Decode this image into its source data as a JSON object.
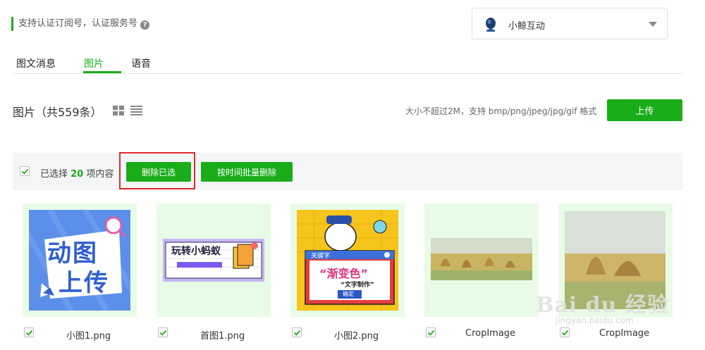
{
  "header": {
    "notice": "支持认证订阅号，认证服务号",
    "help_icon": "?",
    "account_name": "小鲸互动"
  },
  "tabs": [
    {
      "label": "图文消息",
      "active": false
    },
    {
      "label": "图片",
      "active": true
    },
    {
      "label": "语音",
      "active": false
    }
  ],
  "section": {
    "title": "图片（共559条）",
    "upload_hint": "大小不超过2M，支持 bmp/png/jpeg/jpg/gif 格式",
    "upload_label": "上传"
  },
  "toolbar": {
    "selected_prefix": "已选择",
    "selected_count": "20",
    "selected_suffix": "项内容",
    "delete_selected_label": "删除已选",
    "batch_delete_label": "按时间批量删除"
  },
  "images": [
    {
      "name": "小图1.png",
      "checked": true
    },
    {
      "name": "首图1.png",
      "checked": true
    },
    {
      "name": "小图2.png",
      "checked": true
    },
    {
      "name": "CropImage",
      "checked": true
    },
    {
      "name": "CropImage",
      "checked": true
    }
  ],
  "thumb_text": {
    "img1_line1": "动图",
    "img1_line2": "上传",
    "img2_text": "玩转小蚂蚁",
    "img3_label": "关键字",
    "img3_main": "“渐变色”",
    "img3_sub": "“文字制作”",
    "img3_btn": "确定"
  },
  "watermark": {
    "text": "Bai du 经验",
    "sub": "jingyan.baidu.com"
  },
  "colors": {
    "accent": "#1aad19",
    "highlight": "#e02c2c",
    "card_bg": "#e8fbe6"
  }
}
